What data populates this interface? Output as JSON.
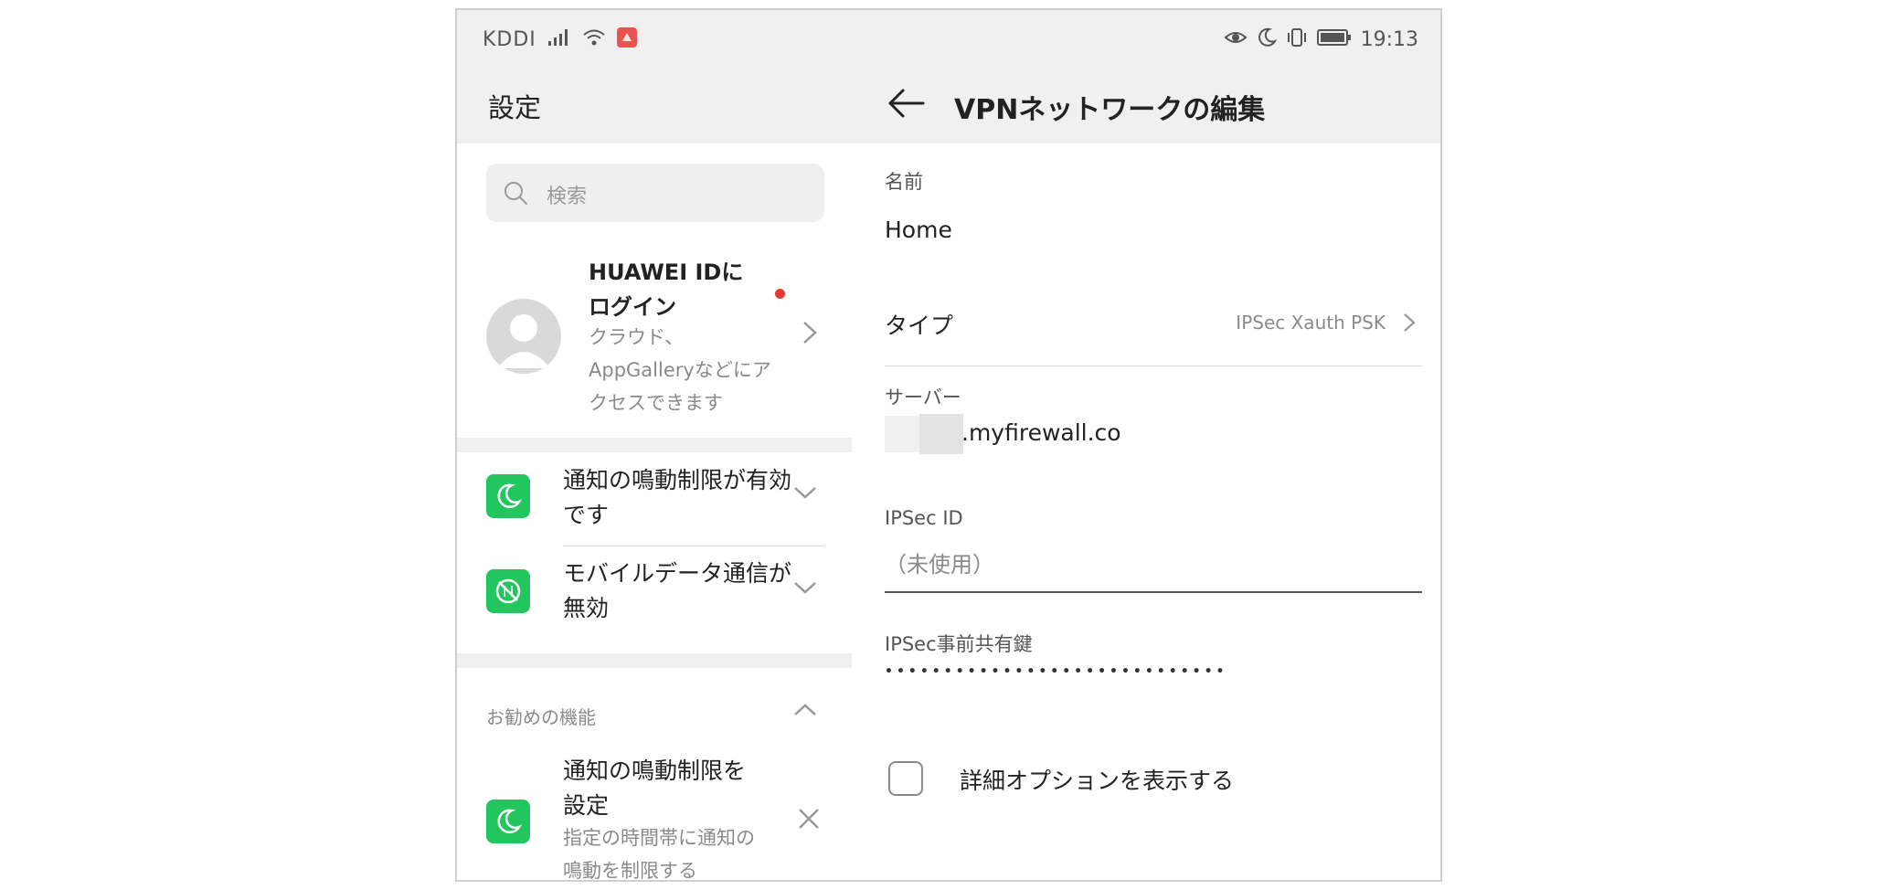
{
  "status_bar": {
    "carrier": "KDDI",
    "time": "19:13",
    "left_icons": [
      "signal-icon",
      "wifi-icon",
      "huawei-icon"
    ],
    "right_icons": [
      "eye-comfort-icon",
      "moon-icon",
      "vibrate-icon",
      "battery-icon"
    ]
  },
  "settings": {
    "title": "設定",
    "search_placeholder": "検索",
    "account": {
      "title": "HUAWEI IDにログイン",
      "subtitle": "クラウド、AppGalleryなどにアクセスできます"
    },
    "status_items": [
      {
        "label": "通知の鳴動制限が有効です",
        "icon": "moon-icon"
      },
      {
        "label": "モバイルデータ通信が無効",
        "icon": "mobile-data-off-icon"
      }
    ],
    "recommended": {
      "header": "お勧めの機能",
      "item": {
        "title": "通知の鳴動制限を設定",
        "subtitle": "指定の時間帯に通知の鳴動を制限する"
      }
    }
  },
  "vpn_edit": {
    "title": "VPNネットワークの編集",
    "name_label": "名前",
    "name_value": "Home",
    "type_label": "タイプ",
    "type_value": "IPSec Xauth PSK",
    "server_label": "サーバー",
    "server_value": ".myfirewall.co",
    "ipsec_id_label": "IPSec ID",
    "ipsec_id_placeholder": "（未使用）",
    "psk_label": "IPSec事前共有鍵",
    "psk_value": "•••••••••••••••••••••••••••••",
    "advanced_label": "詳細オプションを表示する"
  },
  "colors": {
    "accent_green": "#22c55e",
    "notification_dot": "#e53935",
    "header_background": "#f0f0f0"
  }
}
